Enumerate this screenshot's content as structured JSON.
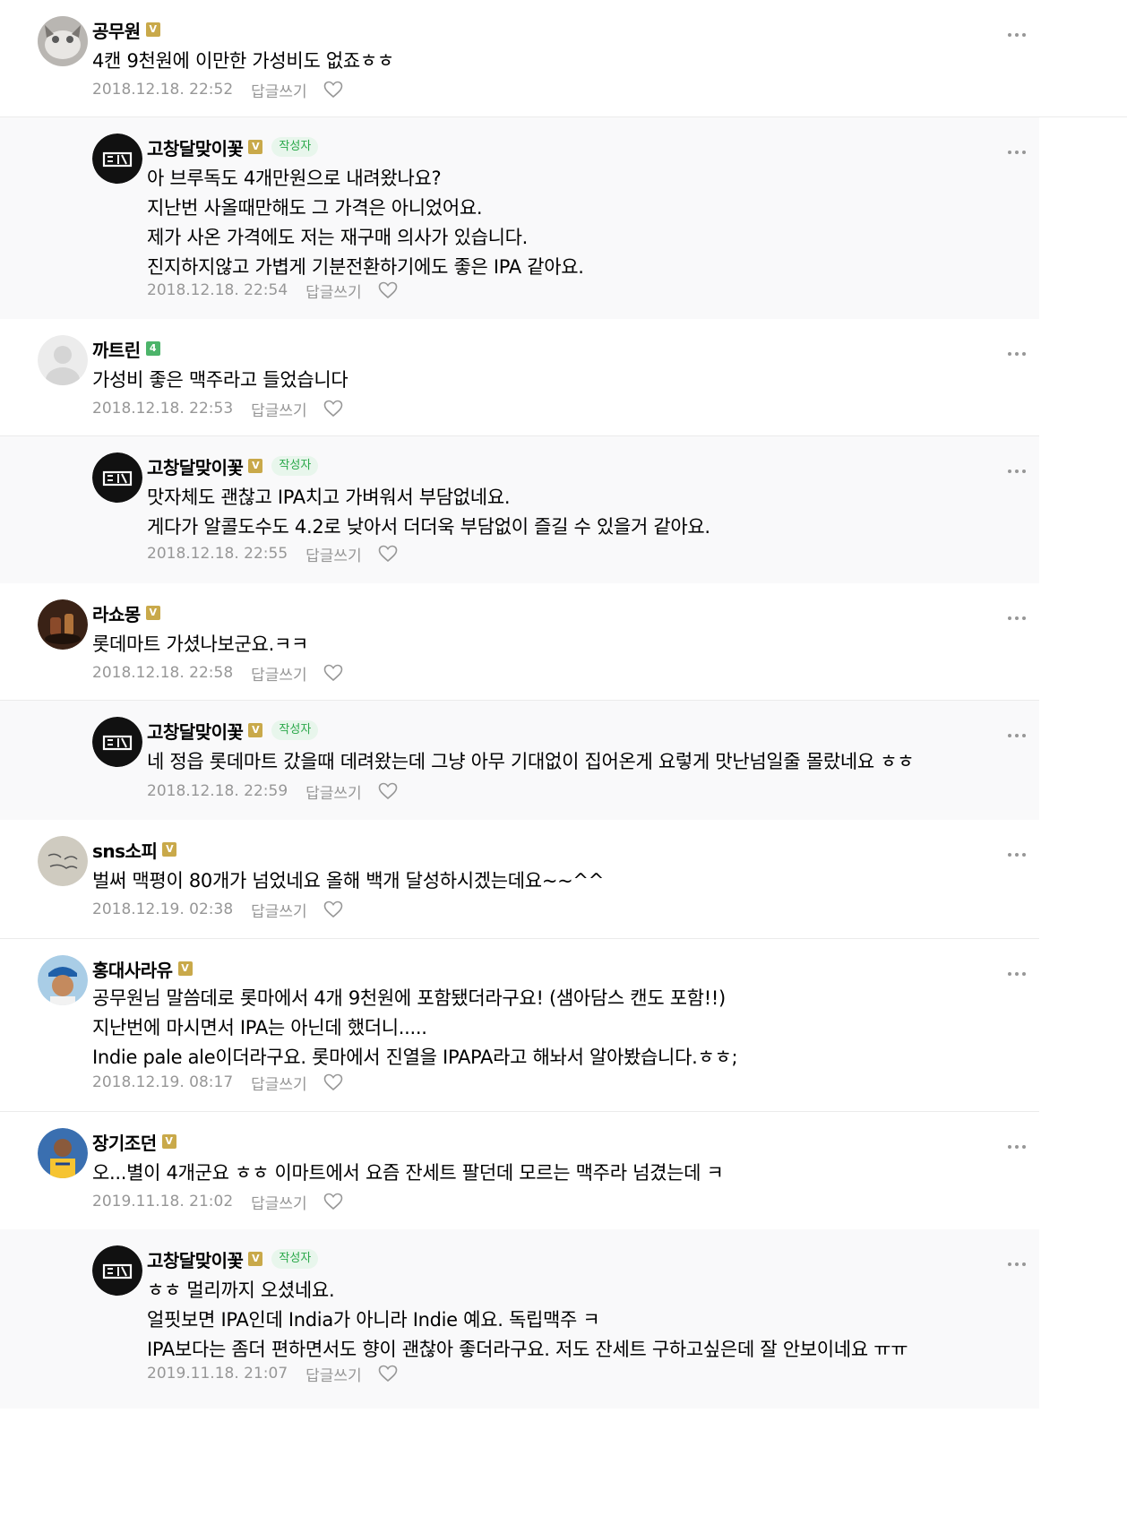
{
  "ui": {
    "reply_label": "답글쓰기",
    "writer_tag": "작성자"
  },
  "comments": [
    {
      "author": "공무원",
      "badge": "gold",
      "is_writer": false,
      "lines": [
        "4캔 9천원에 이만한 가성비도 없죠ㅎㅎ"
      ],
      "date": "2018.12.18. 22:52"
    },
    {
      "author": "고창달맞이꽃",
      "badge": "gold",
      "is_writer": true,
      "lines": [
        "아 브루독도 4개만원으로 내려왔나요?",
        "지난번 사올때만해도 그 가격은 아니었어요.",
        "제가 사온 가격에도 저는 재구매 의사가 있습니다.",
        "진지하지않고 가볍게 기분전환하기에도 좋은 IPA 같아요."
      ],
      "date": "2018.12.18. 22:54"
    },
    {
      "author": "까트린",
      "badge": "green",
      "is_writer": false,
      "lines": [
        "가성비 좋은 맥주라고 들었습니다"
      ],
      "date": "2018.12.18. 22:53"
    },
    {
      "author": "고창달맞이꽃",
      "badge": "gold",
      "is_writer": true,
      "lines": [
        "맛자체도 괜찮고 IPA치고 가벼워서 부담없네요.",
        "게다가 알콜도수도 4.2로 낮아서 더더욱 부담없이 즐길 수 있을거 같아요."
      ],
      "date": "2018.12.18. 22:55"
    },
    {
      "author": "라쇼몽",
      "badge": "gold",
      "is_writer": false,
      "lines": [
        "롯데마트 가셨나보군요.ㅋㅋ"
      ],
      "date": "2018.12.18. 22:58"
    },
    {
      "author": "고창달맞이꽃",
      "badge": "gold",
      "is_writer": true,
      "lines": [
        "네 정읍 롯데마트 갔을때 데려왔는데 그냥 아무 기대없이 집어온게 요렇게 맛난넘일줄 몰랐네요 ㅎㅎ"
      ],
      "date": "2018.12.18. 22:59"
    },
    {
      "author": "sns소피",
      "badge": "gold",
      "is_writer": false,
      "lines": [
        "벌써 맥평이 80개가 넘었네요 올해 백개 달성하시겠는데요~~^^"
      ],
      "date": "2018.12.19. 02:38"
    },
    {
      "author": "홍대사라유",
      "badge": "gold",
      "is_writer": false,
      "lines": [
        "공무원님 말씀데로 롯마에서 4개 9천원에 포함됐더라구요! (샘아담스 캔도 포함!!)",
        "지난번에 마시면서 IPA는 아닌데 했더니.....",
        "Indie pale ale이더라구요. 롯마에서 진열을 IPAPA라고 해놔서 알아봤습니다.ㅎㅎ;"
      ],
      "date": "2018.12.19. 08:17"
    },
    {
      "author": "장기조던",
      "badge": "gold",
      "is_writer": false,
      "lines": [
        "오...별이 4개군요 ㅎㅎ 이마트에서 요즘 잔세트 팔던데 모르는 맥주라 넘겼는데 ㅋ"
      ],
      "date": "2019.11.18. 21:02"
    },
    {
      "author": "고창달맞이꽃",
      "badge": "gold",
      "is_writer": true,
      "lines": [
        "ㅎㅎ 멀리까지 오셨네요.",
        "얼핏보면 IPA인데 India가 아니라 Indie 예요. 독립맥주 ㅋ",
        "IPA보다는 좀더 편하면서도 향이 괜찮아 좋더라구요. 저도 잔세트 구하고싶은데 잘 안보이네요 ㅠㅠ"
      ],
      "date": "2019.11.18. 21:07"
    }
  ]
}
